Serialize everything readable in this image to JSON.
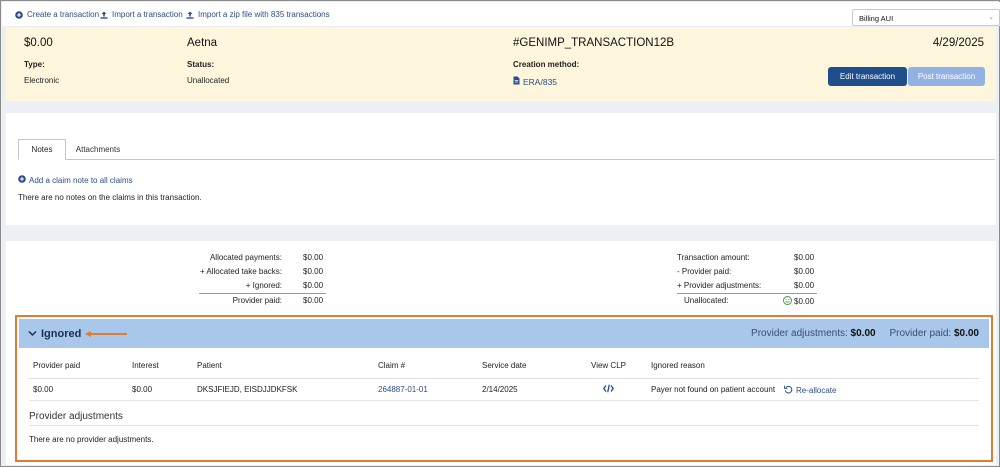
{
  "topbar": {
    "links": [
      {
        "label": "Create a transaction",
        "icon": "plus-circle-icon"
      },
      {
        "label": "Import a transaction",
        "icon": "upload-icon"
      },
      {
        "label": "Import a zip file with 835 transactions",
        "icon": "upload-icon"
      }
    ],
    "location_select": "Billing AUI"
  },
  "header": {
    "amount": "$0.00",
    "payer": "Aetna",
    "transaction_id": "#GENIMP_TRANSACTION12B",
    "date": "4/29/2025",
    "type_label": "Type:",
    "type_value": "Electronic",
    "status_label": "Status:",
    "status_value": "Unallocated",
    "creation_label": "Creation method:",
    "creation_value": "ERA/835",
    "edit_button": "Edit transaction",
    "post_button": "Post transaction"
  },
  "notes": {
    "tabs": [
      "Notes",
      "Attachments"
    ],
    "add_note": "Add a claim note to all claims",
    "empty_text": "There are no notes on the claims in this transaction."
  },
  "allocation_left": [
    {
      "label": "Allocated payments:",
      "value": "$0.00"
    },
    {
      "label": "+ Allocated take backs:",
      "value": "$0.00"
    },
    {
      "label": "+ Ignored:",
      "value": "$0.00"
    },
    {
      "label": "Provider paid:",
      "value": "$0.00"
    }
  ],
  "allocation_right": [
    {
      "label": "Transaction amount:",
      "value": "$0.00"
    },
    {
      "label": "-  Provider paid:",
      "value": "$0.00"
    },
    {
      "label": "+ Provider adjustments:",
      "value": "$0.00"
    },
    {
      "label": "Unallocated:",
      "value": "$0.00"
    }
  ],
  "ignored": {
    "title": "Ignored",
    "summary_adj_label": "Provider adjustments:",
    "summary_adj_value": "$0.00",
    "summary_paid_label": "Provider paid:",
    "summary_paid_value": "$0.00",
    "columns": [
      "Provider paid",
      "Interest",
      "Patient",
      "Claim #",
      "Service date",
      "View CLP",
      "Ignored reason"
    ],
    "row": {
      "provider_paid": "$0.00",
      "interest": "$0.00",
      "patient": "DKSJFIEJD, EISDJJDKFSK",
      "claim": "264887-01-01",
      "service_date": "2/14/2025",
      "reason": "Payer not found on patient account",
      "reallocate": "Re-allocate"
    },
    "provider_adjustments_title": "Provider adjustments",
    "no_adjustments": "There are no provider adjustments."
  },
  "colors": {
    "header_bg": "#fdf6dc",
    "primary": "#1f4e8c",
    "link": "#2a4d8a",
    "ignored_bar": "#a9c6eb",
    "highlight_border": "#e07b34"
  }
}
